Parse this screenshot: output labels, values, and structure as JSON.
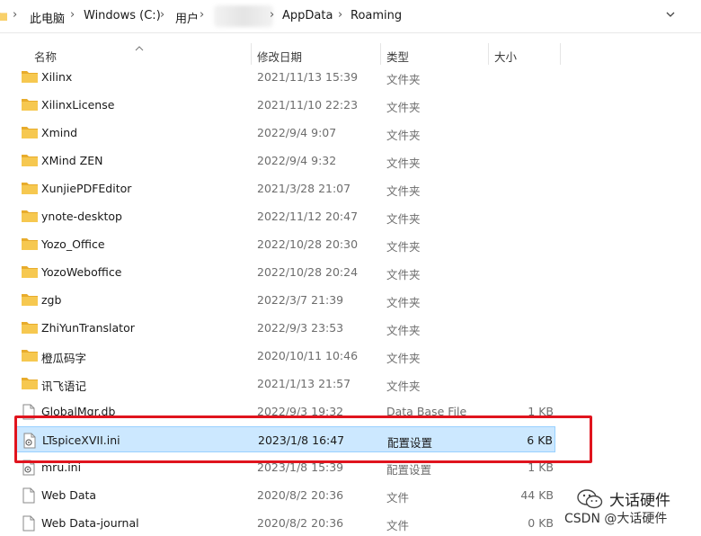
{
  "address_bar": {
    "crumbs": [
      "此电脑",
      "Windows (C:)",
      "用户",
      "AppData",
      "Roaming"
    ],
    "separator": ">"
  },
  "columns": {
    "name": "名称",
    "date": "修改日期",
    "type": "类型",
    "size": "大小"
  },
  "files": [
    {
      "name": "Xilinx",
      "date": "2021/11/13 15:39",
      "type": "文件夹",
      "size": "",
      "icon": "folder-icon"
    },
    {
      "name": "XilinxLicense",
      "date": "2021/11/10 22:23",
      "type": "文件夹",
      "size": "",
      "icon": "folder-icon"
    },
    {
      "name": "Xmind",
      "date": "2022/9/4 9:07",
      "type": "文件夹",
      "size": "",
      "icon": "folder-icon"
    },
    {
      "name": "XMind ZEN",
      "date": "2022/9/4 9:32",
      "type": "文件夹",
      "size": "",
      "icon": "folder-icon"
    },
    {
      "name": "XunjiePDFEditor",
      "date": "2021/3/28 21:07",
      "type": "文件夹",
      "size": "",
      "icon": "folder-icon"
    },
    {
      "name": "ynote-desktop",
      "date": "2022/11/12 20:47",
      "type": "文件夹",
      "size": "",
      "icon": "folder-icon"
    },
    {
      "name": "Yozo_Office",
      "date": "2022/10/28 20:30",
      "type": "文件夹",
      "size": "",
      "icon": "folder-icon"
    },
    {
      "name": "YozoWeboffice",
      "date": "2022/10/28 20:24",
      "type": "文件夹",
      "size": "",
      "icon": "folder-icon"
    },
    {
      "name": "zgb",
      "date": "2022/3/7 21:39",
      "type": "文件夹",
      "size": "",
      "icon": "folder-icon"
    },
    {
      "name": "ZhiYunTranslator",
      "date": "2022/9/3 23:53",
      "type": "文件夹",
      "size": "",
      "icon": "folder-icon"
    },
    {
      "name": "橙瓜码字",
      "date": "2020/10/11 10:46",
      "type": "文件夹",
      "size": "",
      "icon": "folder-icon"
    },
    {
      "name": "讯飞语记",
      "date": "2021/1/13 21:57",
      "type": "文件夹",
      "size": "",
      "icon": "folder-icon"
    },
    {
      "name": "GlobalMgr.db",
      "date": "2022/9/3 19:32",
      "type": "Data Base File",
      "size": "1 KB",
      "icon": "file-icon"
    },
    {
      "name": "LTspiceXVII.ini",
      "date": "2023/1/8 16:47",
      "type": "配置设置",
      "size": "6 KB",
      "icon": "settings-file-icon",
      "selected": true
    },
    {
      "name": "mru.ini",
      "date": "2023/1/8 15:39",
      "type": "配置设置",
      "size": "1 KB",
      "icon": "settings-file-icon"
    },
    {
      "name": "Web Data",
      "date": "2020/8/2 20:36",
      "type": "文件",
      "size": "44 KB",
      "icon": "file-icon"
    },
    {
      "name": "Web Data-journal",
      "date": "2020/8/2 20:36",
      "type": "文件",
      "size": "0 KB",
      "icon": "file-icon"
    }
  ],
  "watermark": {
    "title": "大话硬件",
    "credit": "CSDN @大话硬件"
  },
  "colors": {
    "folder": "#f4c04e",
    "selection_bg": "#cce8ff",
    "selection_border": "#99d1ff",
    "highlight_box": "#e0141e"
  }
}
